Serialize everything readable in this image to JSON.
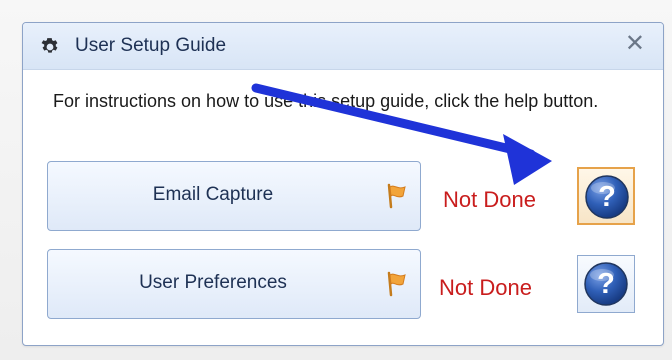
{
  "dialog": {
    "title": "User Setup Guide",
    "close_glyph": "✕",
    "title_icon": "gear-icon",
    "instructions": "For instructions on how to use this setup guide, click the help button."
  },
  "steps": [
    {
      "label": "Email Capture",
      "status": "Not Done",
      "flag_icon": "orange-flag-icon",
      "help_icon": "question-mark-icon",
      "help_focused": true
    },
    {
      "label": "User Preferences",
      "status": "Not Done",
      "flag_icon": "orange-flag-icon",
      "help_icon": "question-mark-icon",
      "help_focused": false
    }
  ],
  "colors": {
    "accent": "#1e3154",
    "status_red": "#c91d1d",
    "annotation_arrow": "#1f33d8",
    "focus_orange": "#e6a24a"
  }
}
